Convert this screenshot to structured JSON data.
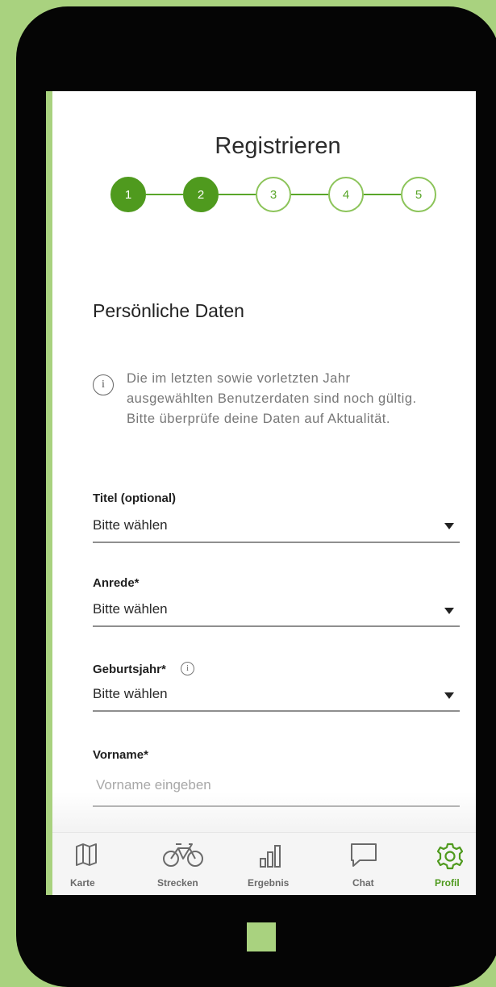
{
  "page": {
    "title": "Registrieren",
    "steps": [
      {
        "label": "1",
        "state": "done"
      },
      {
        "label": "2",
        "state": "done"
      },
      {
        "label": "3",
        "state": "todo"
      },
      {
        "label": "4",
        "state": "todo"
      },
      {
        "label": "5",
        "state": "todo"
      }
    ],
    "section_title": "Persönliche Daten",
    "info_icon_glyph": "i",
    "info_text": "Die im letzten sowie vorletzten Jahr ausgewählten Benutzerdaten sind noch gültig. Bitte überprüfe deine Daten auf Aktualität."
  },
  "form": {
    "titel": {
      "label": "Titel (optional)",
      "value": "Bitte wählen"
    },
    "anrede": {
      "label": "Anrede*",
      "value": "Bitte wählen"
    },
    "geburtsjahr": {
      "label": "Geburtsjahr*",
      "value": "Bitte wählen",
      "info_glyph": "i"
    },
    "vorname": {
      "label": "Vorname*",
      "placeholder": "Vorname eingeben"
    }
  },
  "tabbar": {
    "items": [
      {
        "label": "Karte",
        "icon": "map-icon",
        "active": false
      },
      {
        "label": "Strecken",
        "icon": "bicycle-icon",
        "active": false
      },
      {
        "label": "Ergebnis",
        "icon": "bar-chart-icon",
        "active": false
      },
      {
        "label": "Chat",
        "icon": "chat-bubble-icon",
        "active": false
      },
      {
        "label": "Profil",
        "icon": "gear-icon",
        "active": true
      }
    ]
  },
  "colors": {
    "accent": "#4f9a1e",
    "background": "#a9d27f",
    "inactive_tab": "#6a6a6a"
  }
}
